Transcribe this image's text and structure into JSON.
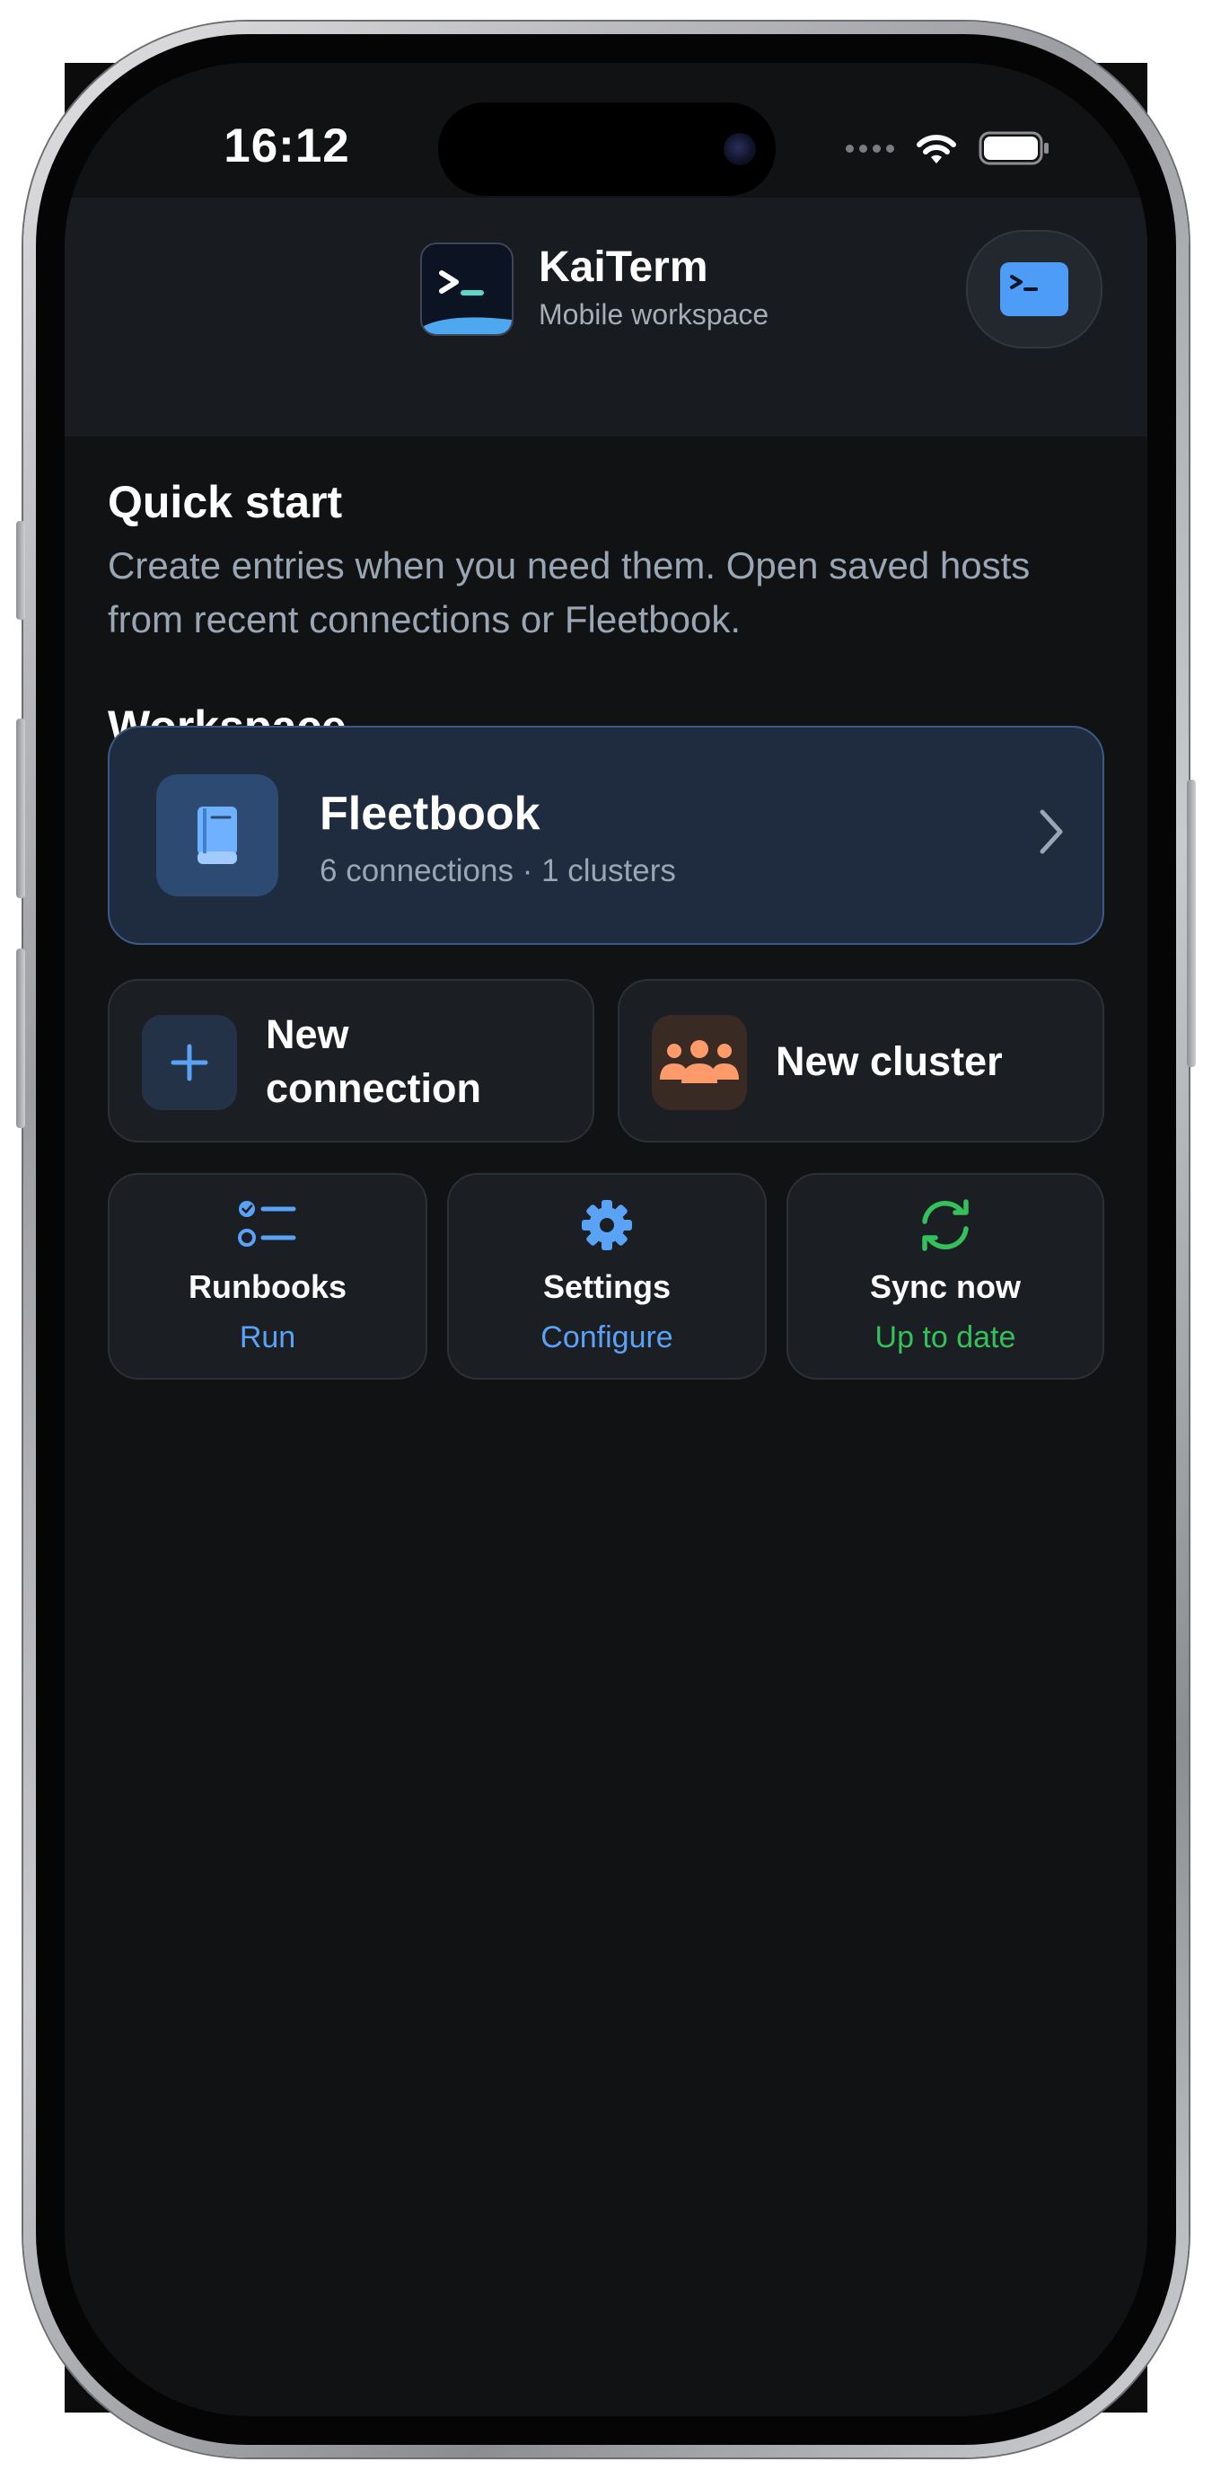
{
  "status_bar": {
    "time": "16:12"
  },
  "header": {
    "app_name": "KaiTerm",
    "subtitle": "Mobile workspace"
  },
  "quick_start": {
    "title": "Quick start",
    "description": "Create entries when you need them. Open saved hosts from recent connections or Fleetbook."
  },
  "workspace": {
    "title": "Workspace",
    "fleetbook": {
      "title": "Fleetbook",
      "subtitle": "6 connections · 1 clusters"
    },
    "new_connection": {
      "label": "New connection"
    },
    "new_cluster": {
      "label": "New cluster"
    },
    "tiles": {
      "runbooks": {
        "title": "Runbooks",
        "action": "Run"
      },
      "settings": {
        "title": "Settings",
        "action": "Configure"
      },
      "sync": {
        "title": "Sync now",
        "status": "Up to date"
      }
    }
  },
  "colors": {
    "accent_blue": "#5aa2f6",
    "success_green": "#34c05b",
    "cluster_orange": "#ff9a6b"
  },
  "icons": {
    "app": "terminal-icon",
    "header_button": "terminal-icon",
    "fleetbook": "book-icon",
    "new_connection": "plus-icon",
    "new_cluster": "people-icon",
    "runbooks": "checklist-icon",
    "settings": "gear-icon",
    "sync": "sync-icon"
  }
}
